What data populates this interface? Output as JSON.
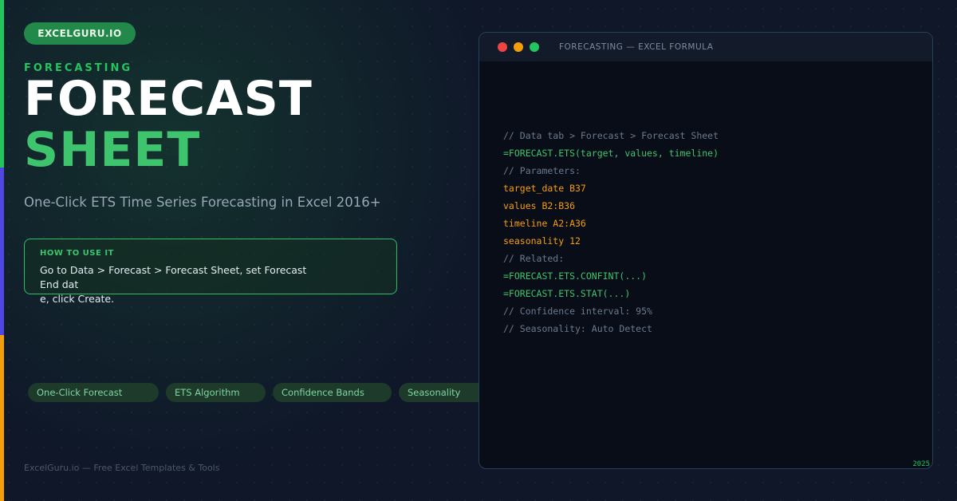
{
  "brand": {
    "label": "EXCELGURU.IO"
  },
  "header": {
    "eyebrow": "FORECASTING",
    "title_line1": "FORECAST",
    "title_line2": "SHEET",
    "subtitle": "One-Click ETS Time Series Forecasting in Excel 2016+"
  },
  "howto": {
    "label": "HOW TO USE IT",
    "text": "Go to Data > Forecast > Forecast Sheet, set Forecast End dat\ne, click Create."
  },
  "tags": [
    "One-Click Forecast",
    "ETS Algorithm",
    "Confidence Bands",
    "Seasonality"
  ],
  "footer": "ExcelGuru.io — Free Excel Templates & Tools",
  "window": {
    "title": "FORECASTING — EXCEL FORMULA",
    "code_lines": [
      {
        "type": "comment",
        "text": "// Data tab > Forecast > Forecast Sheet"
      },
      {
        "type": "formula",
        "text": "=FORECAST.ETS(target, values, timeline)"
      },
      {
        "type": "comment",
        "text": "// Parameters:"
      },
      {
        "type": "param",
        "text": "target_date B37"
      },
      {
        "type": "param",
        "text": "values B2:B36"
      },
      {
        "type": "param",
        "text": "timeline A2:A36"
      },
      {
        "type": "param",
        "text": "seasonality 12"
      },
      {
        "type": "comment",
        "text": "// Related:"
      },
      {
        "type": "formula",
        "text": "=FORECAST.ETS.CONFINT(...)"
      },
      {
        "type": "formula",
        "text": "=FORECAST.ETS.STAT(...)"
      },
      {
        "type": "comment",
        "text": "// Confidence interval: 95%"
      },
      {
        "type": "comment",
        "text": "// Seasonality: Auto Detect"
      }
    ],
    "corner_mark": "2025"
  },
  "colors": {
    "accent_green": "#22c55e",
    "accent_indigo": "#4f46e5",
    "accent_amber": "#f59e0b",
    "background": "#0f1729"
  }
}
